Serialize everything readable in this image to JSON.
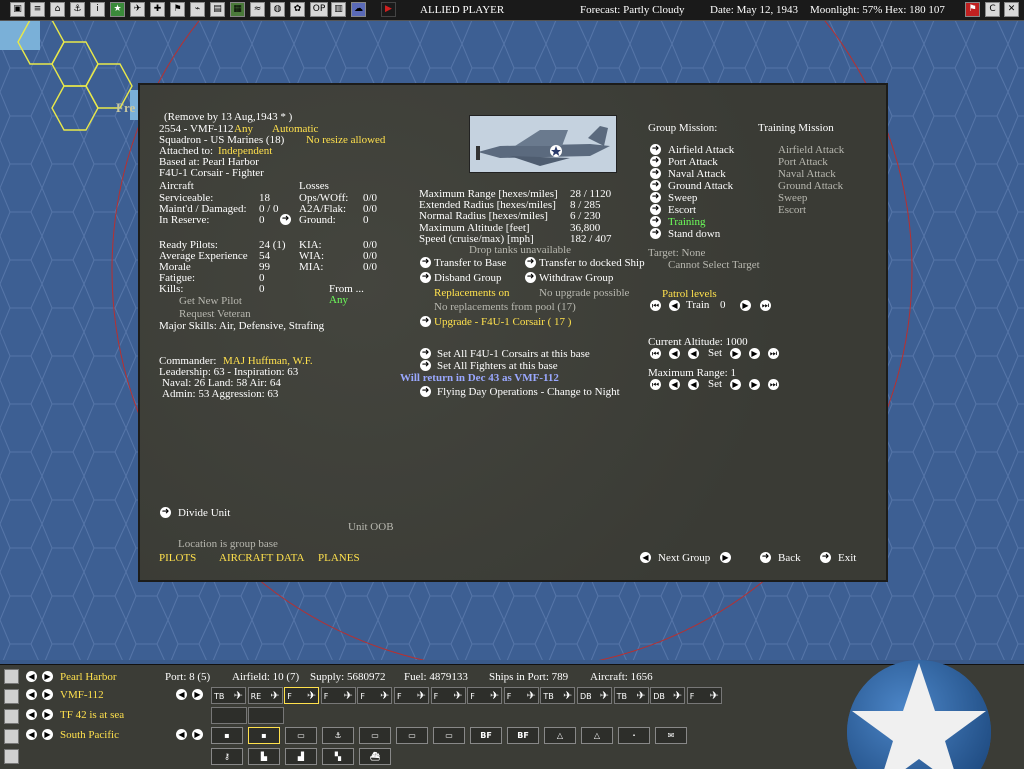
{
  "topbar": {
    "title": "ALLIED PLAYER",
    "forecast": "Forecast: Partly Cloudy",
    "date": "Date: May 12, 1943",
    "moonlight": "Moonlight: 57%",
    "hex": "Hex: 180 107",
    "op_label": "OP",
    "r_label": "C"
  },
  "map": {
    "label_fre": "Fre"
  },
  "unit": {
    "remove_by": "(Remove by 13 Aug,1943 * )",
    "id": "2554 - VMF-112",
    "any": "Any",
    "automatic": "Automatic",
    "squadron": "Squadron - US Marines (18)",
    "no_resize": "No resize allowed",
    "attached_label": "Attached to:",
    "attached_value": "Independent",
    "based_at": "Based at: Pearl Harbor",
    "aircraft_type": "F4U-1 Corsair - Fighter"
  },
  "aircraft": {
    "header": "Aircraft",
    "serviceable_label": "Serviceable:",
    "serviceable": "18",
    "maintd_label": "Maint'd / Damaged:",
    "maintd": "0 / 0",
    "reserve_label": "In Reserve:",
    "reserve": "0",
    "losses_header": "Losses",
    "ops_label": "Ops/WOff:",
    "ops": "0/0",
    "a2a_label": "A2A/Flak:",
    "a2a": "0/0",
    "ground_label": "Ground:",
    "ground": "0"
  },
  "pilots": {
    "ready_label": "Ready Pilots:",
    "ready": "24 (1)",
    "exp_label": "Average Experience",
    "exp": "54",
    "morale_label": "Morale",
    "morale": "99",
    "fatigue_label": "Fatigue:",
    "fatigue": "0",
    "kills_label": "Kills:",
    "kills": "0",
    "kia_label": "KIA:",
    "kia": "0/0",
    "wia_label": "WIA:",
    "wia": "0/0",
    "mia_label": "MIA:",
    "mia": "0/0",
    "get_new_pilot": "Get New Pilot",
    "request_veteran": "Request Veteran",
    "from_label": "From ...",
    "from_value": "Any",
    "major_skills": "Major Skills:  Air, Defensive, Strafing"
  },
  "commander": {
    "label": "Commander:",
    "name": "MAJ Huffman, W.F.",
    "leadership": "Leadership: 63 - Inspiration: 63",
    "naval_land_air": "Naval: 26  Land: 58  Air: 64",
    "admin": "Admin: 53  Aggression: 63"
  },
  "specs": {
    "max_range_label": "Maximum Range [hexes/miles]",
    "max_range": "28 / 1120",
    "ext_radius_label": "Extended Radius [hexes/miles]",
    "ext_radius": "8 / 285",
    "norm_radius_label": "Normal Radius [hexes/miles]",
    "norm_radius": "6 / 230",
    "max_alt_label": "Maximum Altitude [feet]",
    "max_alt": "36,800",
    "speed_label": "Speed (cruise/max) [mph]",
    "speed": "182 / 407",
    "drop_tanks": "Drop tanks unavailable"
  },
  "actions": {
    "transfer_base": "Transfer to Base",
    "transfer_ship": "Transfer to docked Ship",
    "disband": "Disband Group",
    "withdraw": "Withdraw Group",
    "replacements_on": "Replacements on",
    "no_upgrade": "No upgrade possible",
    "no_replacements": "No replacements from pool (17)",
    "upgrade": "Upgrade - F4U-1 Corsair  ( 17 )",
    "set_all_corsairs": "Set All F4U-1 Corsairs at this base",
    "set_all_fighters": "Set All Fighters at this base",
    "will_return": "Will return in Dec 43 as VMF-112",
    "flying_ops": "Flying Day Operations - Change to Night"
  },
  "missions": {
    "group_header": "Group Mission:",
    "training_header": "Training Mission",
    "group": [
      "Airfield Attack",
      "Port Attack",
      "Naval Attack",
      "Ground Attack",
      "Sweep",
      "Escort",
      "Training",
      "Stand down"
    ],
    "training": [
      "Airfield Attack",
      "Port Attack",
      "Naval Attack",
      "Ground Attack",
      "Sweep",
      "Escort"
    ],
    "target": "Target: None",
    "cannot_select": "Cannot Select Target",
    "patrol_levels": "Patrol levels",
    "train_label": "Train",
    "train_value": "0",
    "current_alt": "Current Altitude: 1000",
    "set_label": "Set",
    "max_range": "Maximum Range: 1"
  },
  "footer": {
    "divide_unit": "Divide Unit",
    "unit_oob": "Unit OOB",
    "location": "Location is group base",
    "pilots": "PILOTS",
    "aircraft_data": "AIRCRAFT DATA",
    "planes": "PLANES",
    "next_group": "Next Group",
    "back": "Back",
    "exit": "Exit"
  },
  "bottom": {
    "base": "Pearl Harbor",
    "port": "Port: 8 (5)",
    "airfield": "Airfield: 10 (7)",
    "supply": "Supply: 5680972",
    "fuel": "Fuel: 4879133",
    "ships": "Ships in Port: 789",
    "aircraft": "Aircraft: 1656",
    "unit": "VMF-112",
    "tf": "TF 42 is at sea",
    "region": "South Pacific",
    "slots": [
      "TB",
      "RE",
      "F",
      "F",
      "F",
      "F",
      "F",
      "F",
      "F",
      "TB",
      "DB",
      "TB",
      "DB",
      "F"
    ],
    "cmd_bf1": "BF",
    "cmd_bf2": "BF"
  },
  "colors": {
    "yellow": "#ffe14d",
    "green": "#6dff5a",
    "blue": "#9aa8ff"
  }
}
